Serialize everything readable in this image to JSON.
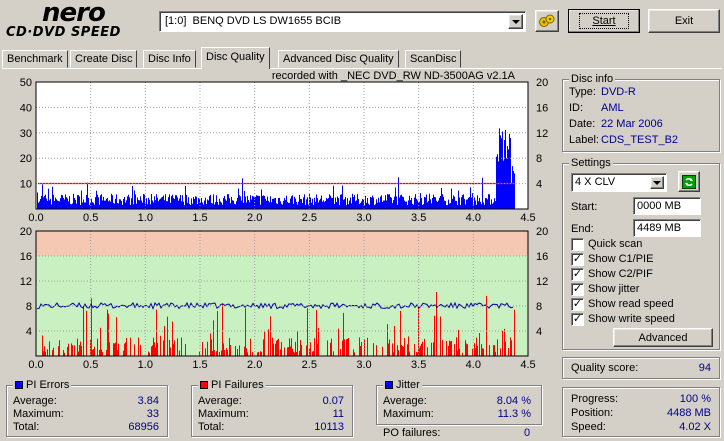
{
  "header": {
    "logo_top": "nero",
    "logo_bottom": "CD·DVD SPEED",
    "drive": "[1:0]  BENQ DVD LS DW1655 BCIB",
    "start_label": "Start",
    "exit_label": "Exit"
  },
  "tabs": [
    "Benchmark",
    "Create Disc",
    "Disc Info",
    "Disc Quality",
    "Advanced Disc Quality",
    "ScanDisc"
  ],
  "active_tab": "Disc Quality",
  "chart_title": "recorded with _NEC     DVD_RW ND-3500AG v2.1A",
  "colors": {
    "pie": "#0000ff",
    "pif": "#ff0000",
    "read_speed": "#ff0000",
    "jitter": "#0000a0",
    "band_bad": "#f5c8b4",
    "band_ok": "#c8f0c0"
  },
  "chart_data": [
    {
      "type": "bar",
      "series": [
        {
          "name": "PI Errors",
          "values_desc": "blue bars per position"
        },
        {
          "name": "read speed",
          "values_desc": "red line ~4X"
        }
      ],
      "x_ticks": [
        "0.0",
        "0.5",
        "1.0",
        "1.5",
        "2.0",
        "2.5",
        "3.0",
        "3.5",
        "4.0",
        "4.5"
      ],
      "xlim": [
        0,
        4.5
      ],
      "y_left_ticks": [
        "10",
        "20",
        "30",
        "40",
        "50"
      ],
      "ylim_left": [
        0,
        50
      ],
      "y_right_ticks": [
        "4",
        "8",
        "12",
        "16",
        "20"
      ],
      "ylim_right": [
        0,
        20
      ],
      "pie_baseline": 3.84,
      "pie_max": 33,
      "pie_spike_start": 4.2,
      "read_speed": 4.02
    },
    {
      "type": "bar",
      "series": [
        {
          "name": "PI Failures",
          "values_desc": "red bars"
        },
        {
          "name": "Jitter",
          "values_desc": "blue line ~8%"
        }
      ],
      "x_ticks": [
        "0.0",
        "0.5",
        "1.0",
        "1.5",
        "2.0",
        "2.5",
        "3.0",
        "3.5",
        "4.0",
        "4.5"
      ],
      "xlim": [
        0,
        4.5
      ],
      "y_left_ticks": [
        "4",
        "8",
        "12",
        "16",
        "20"
      ],
      "ylim_left": [
        0,
        20
      ],
      "y_right_ticks": [
        "4",
        "8",
        "12",
        "16",
        "20"
      ],
      "ylim_right": [
        0,
        20
      ],
      "bands": [
        {
          "from": 16,
          "to": 20,
          "kind": "bad"
        },
        {
          "from": 0,
          "to": 16,
          "kind": "ok"
        }
      ],
      "jitter_avg": 8.04,
      "pif_max": 11
    }
  ],
  "disc_info": {
    "title": "Disc info",
    "type_label": "Type:",
    "type": "DVD-R",
    "id_label": "ID:",
    "id": "AML",
    "date_label": "Date:",
    "date": "22 Mar 2006",
    "disc_label_label": "Label:",
    "disc_label": "CDS_TEST_B2"
  },
  "settings": {
    "title": "Settings",
    "speed": "4 X CLV",
    "start_label": "Start:",
    "start": "0000 MB",
    "end_label": "End:",
    "end": "4489 MB",
    "checks": [
      {
        "label": "Quick scan",
        "checked": false
      },
      {
        "label": "Show C1/PIE",
        "checked": true
      },
      {
        "label": "Show C2/PIF",
        "checked": true
      },
      {
        "label": "Show jitter",
        "checked": true
      },
      {
        "label": "Show read speed",
        "checked": true
      },
      {
        "label": "Show write speed",
        "checked": true
      }
    ],
    "advanced_label": "Advanced"
  },
  "quality": {
    "label": "Quality score:",
    "value": "94"
  },
  "progress": {
    "progress_label": "Progress:",
    "progress": "100 %",
    "position_label": "Position:",
    "position": "4488 MB",
    "speed_label": "Speed:",
    "speed": "4.02 X"
  },
  "pi_errors": {
    "title": "PI Errors",
    "average_label": "Average:",
    "average": "3.84",
    "maximum_label": "Maximum:",
    "maximum": "33",
    "total_label": "Total:",
    "total": "68956"
  },
  "pi_failures": {
    "title": "PI Failures",
    "average_label": "Average:",
    "average": "0.07",
    "maximum_label": "Maximum:",
    "maximum": "11",
    "total_label": "Total:",
    "total": "10113"
  },
  "jitter": {
    "title": "Jitter",
    "average_label": "Average:",
    "average": "8.04 %",
    "maximum_label": "Maximum:",
    "maximum": "11.3 %",
    "po_label": "PO failures:",
    "po": "0"
  }
}
